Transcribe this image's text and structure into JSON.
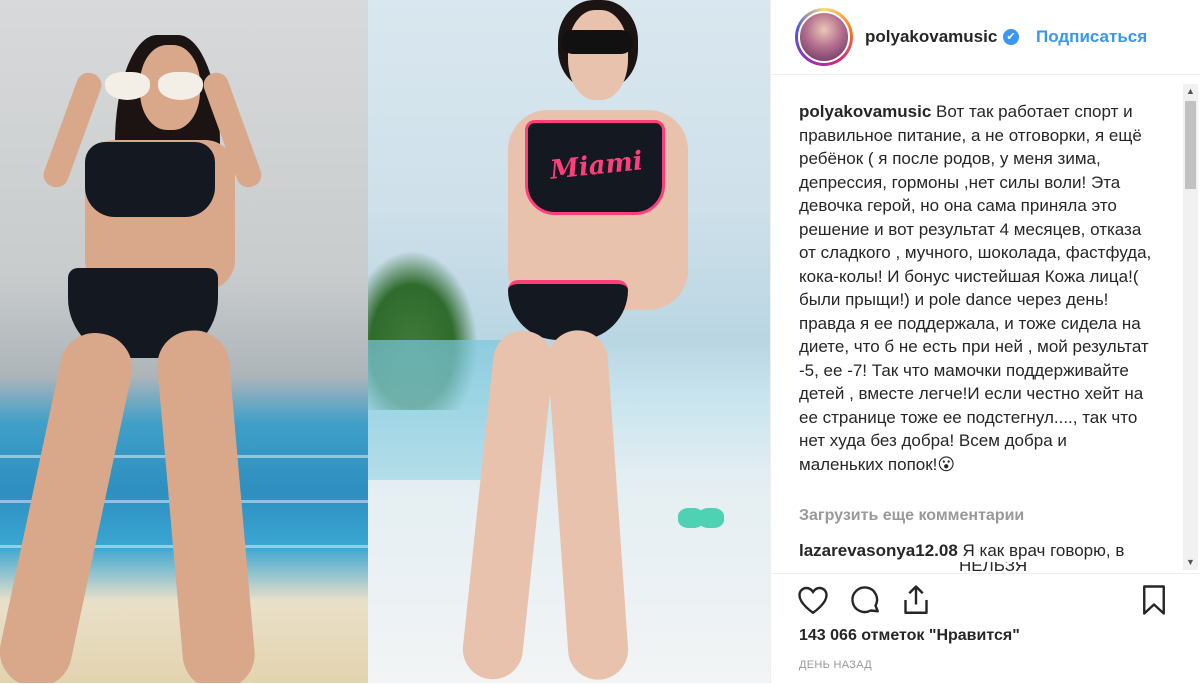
{
  "post": {
    "username": "polyakovamusic",
    "follow_label": "Подписаться",
    "caption_text": "Вот так работает спорт и правильное питание, а не отговорки, я ещё ребёнок ( я после родов, у меня зима, депрессия, гормоны ,нет силы воли! Эта девочка герой, но она сама приняла это решение и вот результат 4 месяцев, отказа от сладкого , мучного, шоколада, фастфуда, кока-колы! И бонус чистейшая Кожа лица!( были прыщи!) и pole dance через день! правда я ее поддержала, и тоже сидела на диете, что б не есть при ней , мой результат -5, ее -7! Так что мамочки поддерживайте детей , вместе легче!И если честно хейт на ее странице тоже ее подстегнул...., так что нет худа без добра! Всем добра и маленьких попок!😮",
    "load_more_label": "Загрузить еще комментарии",
    "comment": {
      "username": "lazarevasonya12.08",
      "text": "Я как врач говорю, в",
      "text_cut": "НЕЛЬЗЯ"
    },
    "likes_label": "143 066 отметок \"Нравится\"",
    "time_label": "ДЕНЬ НАЗАД",
    "photo_text": "Miami"
  },
  "colors": {
    "accent": "#3897f0",
    "text": "#262626",
    "muted": "#999999",
    "bikini_trim": "#ff3f7a"
  },
  "icons": [
    "heart-icon",
    "comment-icon",
    "share-icon",
    "bookmark-icon",
    "verified-icon"
  ]
}
